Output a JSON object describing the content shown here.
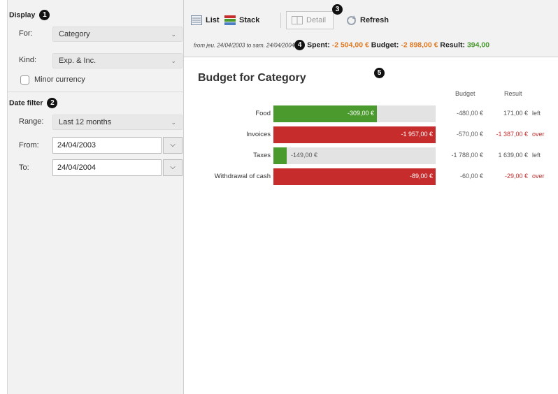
{
  "colors": {
    "green": "#4a9a2e",
    "red": "#c62c2c",
    "orange": "#e07a22",
    "track": "#e3e3e3",
    "badge": "#111111"
  },
  "badges": {
    "display": "1",
    "date_filter": "2",
    "toolbar": "3",
    "summary": "4",
    "report": "5"
  },
  "display": {
    "title": "Display",
    "for_label": "For:",
    "for_value": "Category",
    "kind_label": "Kind:",
    "kind_value": "Exp. & Inc.",
    "minor_currency": "Minor currency"
  },
  "date_filter": {
    "title": "Date filter",
    "range_label": "Range:",
    "range_value": "Last 12 months",
    "from_label": "From:",
    "from_value": "24/04/2003",
    "to_label": "To:",
    "to_value": "24/04/2004"
  },
  "toolbar": {
    "list": "List",
    "stack": "Stack",
    "detail": "Detail",
    "refresh": "Refresh"
  },
  "summary": {
    "range": "from jeu. 24/04/2003 to sam. 24/04/2004",
    "spent_label": "Spent:",
    "spent_value": "-2 504,00 €",
    "budget_label": "Budget:",
    "budget_value": "-2 898,00 €",
    "result_label": "Result:",
    "result_value": "394,00"
  },
  "report": {
    "title": "Budget for Category",
    "col_budget": "Budget",
    "col_result": "Result",
    "rows": [
      {
        "category": "Food",
        "spent": "-309,00 €",
        "budget": "-480,00 €",
        "result": "171,00 €",
        "state": "left",
        "fraction": 0.64,
        "color": "#4a9a2e",
        "label_inside": true
      },
      {
        "category": "Invoices",
        "spent": "-1 957,00 €",
        "budget": "-570,00 €",
        "result": "-1 387,00 €",
        "state": "over",
        "fraction": 1.0,
        "color": "#c62c2c",
        "label_inside": true
      },
      {
        "category": "Taxes",
        "spent": "-149,00 €",
        "budget": "-1 788,00 €",
        "result": "1 639,00 €",
        "state": "left",
        "fraction": 0.08,
        "color": "#4a9a2e",
        "label_inside": false
      },
      {
        "category": "Withdrawal of cash",
        "spent": "-89,00 €",
        "budget": "-60,00 €",
        "result": "-29,00 €",
        "state": "over",
        "fraction": 1.0,
        "color": "#c62c2c",
        "label_inside": true
      }
    ]
  }
}
